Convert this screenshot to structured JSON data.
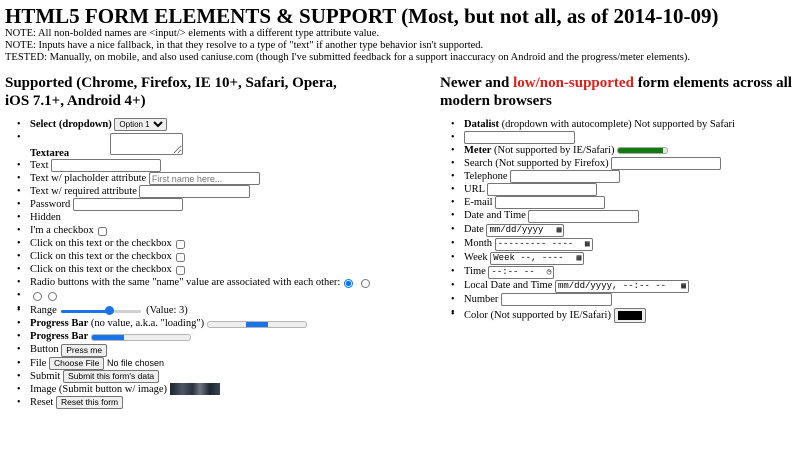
{
  "title": "HTML5 FORM ELEMENTS & SUPPORT (Most, but not all, as of 2014-10-09)",
  "notes": [
    "NOTE: All non-bolded names are <input/> elements with a different type attribute value.",
    "NOTE: Inputs have a nice fallback, in that they resolve to a type of \"text\" if another type behavior isn't supported.",
    "TESTED: Manually, on mobile, and also used caniuse.com (though I've submitted feedback for a support inaccuracy on Android and the progress/meter elements)."
  ],
  "left": {
    "heading": "Supported (Chrome, Firefox, IE 10+, Safari, Opera, iOS 7.1+, Android 4+)",
    "select_label": "Select (dropdown)",
    "select_value": "Option 1",
    "textarea_label": "Textarea",
    "text_label": "Text",
    "placeholder_label": "Text w/ placholder attribute",
    "placeholder_text": "First name here...",
    "required_label": "Text w/ required attribute",
    "password_label": "Password",
    "hidden_label": "Hidden",
    "checkbox1_label": "I'm a checkbox",
    "checkbox2_label": "Click on this text or the checkbox",
    "checkbox3_label": "Click on this text or the checkbox",
    "checkbox4_label": "Click on this text or the checkbox",
    "radio_label": "Radio buttons with the same \"name\" value are associated with each other:",
    "range_label": "Range",
    "range_value_text": "(Value: 3)",
    "range_fraction": 0.6,
    "progress1_label": "Progress Bar",
    "progress1_note": "(no value, a.k.a. \"loading\")",
    "progress2_label": "Progress Bar",
    "progress2_fraction": 0.33,
    "button_label": "Button",
    "button_text": "Press me",
    "file_label": "File",
    "file_button": "Choose File",
    "file_status": "No file chosen",
    "submit_label": "Submit",
    "submit_text": "Submit this form's data",
    "image_label": "Image (Submit button w/ image)",
    "reset_label": "Reset",
    "reset_text": "Reset this form"
  },
  "right": {
    "heading_pre": "Newer and ",
    "heading_red": "low/non-supported",
    "heading_post": " form elements across all modern browsers",
    "datalist_label": "Datalist",
    "datalist_note": "(dropdown with autocomplete) Not supported by Safari",
    "meter_label": "Meter",
    "meter_note": "(Not supported by IE/Safari)",
    "meter_fraction": 0.9,
    "search_label": "Search (Not supported by Firefox)",
    "telephone_label": "Telephone",
    "url_label": "URL",
    "email_label": "E-mail",
    "datetime_label": "Date and Time",
    "date_label": "Date",
    "date_placeholder": "mm/dd/yyyy",
    "month_label": "Month",
    "month_placeholder": "--------- ----",
    "week_label": "Week",
    "week_placeholder": "Week --, ----",
    "time_label": "Time",
    "time_placeholder": "--:-- --",
    "local_label": "Local Date and Time",
    "local_placeholder": "mm/dd/yyyy, --:-- --",
    "number_label": "Number",
    "color_label": "Color (Not supported by IE/Safari)",
    "color_value": "#000000"
  }
}
